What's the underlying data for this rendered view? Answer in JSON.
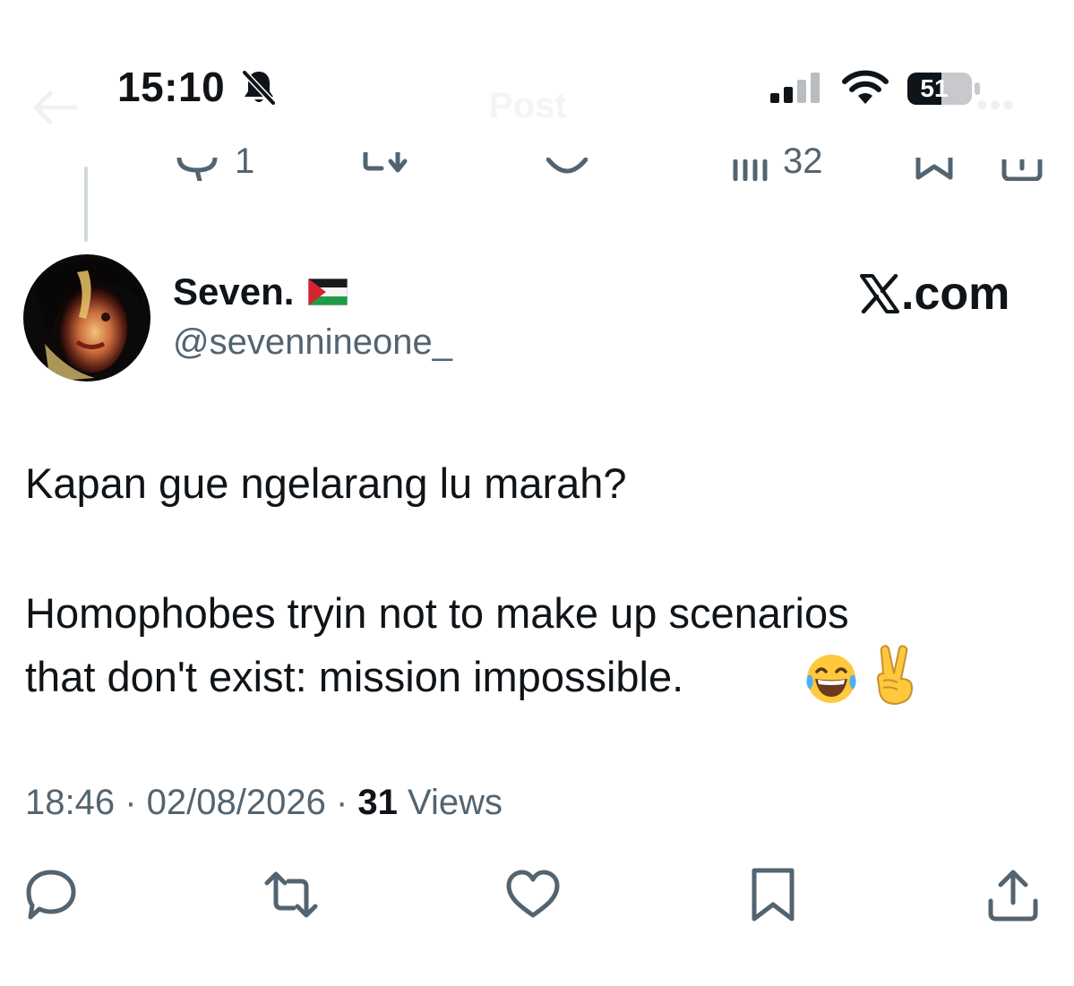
{
  "status_bar": {
    "time": "15:10",
    "battery": "51",
    "icons": [
      "bell-slash-icon",
      "cellular-signal-icon",
      "wifi-icon",
      "battery-icon"
    ]
  },
  "header": {
    "title": "Post",
    "back_icon": "arrow-left-icon",
    "more_icon": "more-icon"
  },
  "previous_tweet": {
    "reply_count": "1",
    "views_count": "32"
  },
  "author": {
    "display_name": "Seven.",
    "handle": "@sevennineone_",
    "flag_icon": "palestine-flag-icon"
  },
  "watermark": ".com",
  "tweet": {
    "line1": "Kapan gue ngelarang lu marah?",
    "line2": "Homophobes tryin not to make up scenarios",
    "line3": "that don't exist: mission impossible.",
    "emojis": [
      "face-with-tears-of-joy-icon",
      "victory-hand-icon"
    ]
  },
  "meta": {
    "time": "18:46",
    "separator": " · ",
    "date": "02/08/2026",
    "views_count": "31",
    "views_label": " Views"
  },
  "actions": [
    "reply-icon",
    "repost-icon",
    "like-icon",
    "bookmark-icon",
    "share-icon"
  ],
  "colors": {
    "text": "#0f1419",
    "secondary": "#536471",
    "divider": "#cfd9de"
  }
}
